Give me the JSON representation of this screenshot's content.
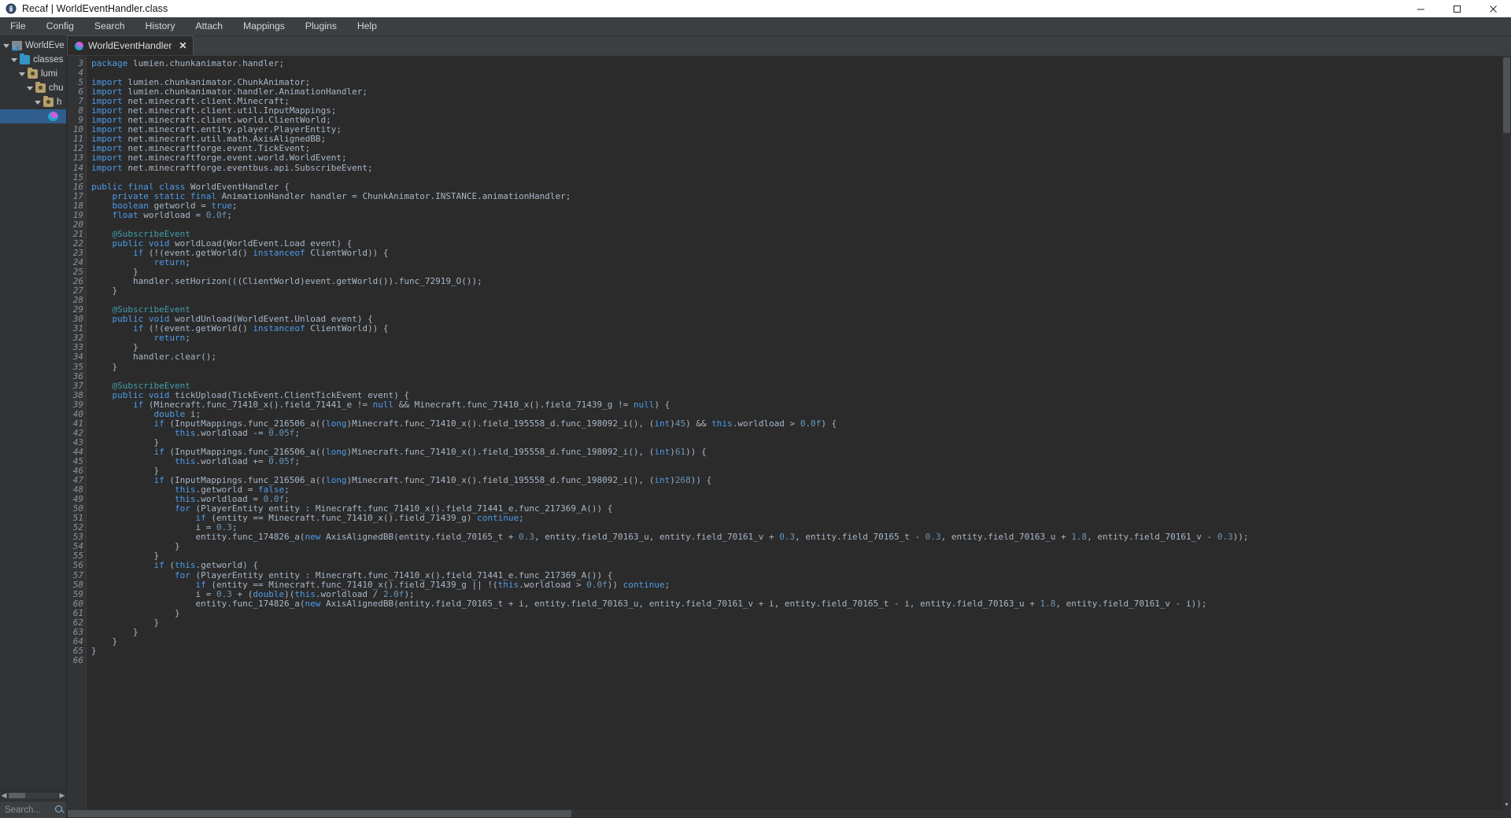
{
  "window": {
    "title": "Recaf | WorldEventHandler.class",
    "icon": "recaf-app-icon",
    "controls": {
      "minimize": "—",
      "maximize": "❐",
      "close": "✕"
    }
  },
  "menubar": {
    "items": [
      {
        "label": "File",
        "name": "menu-file"
      },
      {
        "label": "Config",
        "name": "menu-config"
      },
      {
        "label": "Search",
        "name": "menu-search"
      },
      {
        "label": "History",
        "name": "menu-history"
      },
      {
        "label": "Attach",
        "name": "menu-attach"
      },
      {
        "label": "Mappings",
        "name": "menu-mappings"
      },
      {
        "label": "Plugins",
        "name": "menu-plugins"
      },
      {
        "label": "Help",
        "name": "menu-help"
      }
    ]
  },
  "sidebar": {
    "tree": [
      {
        "label": "WorldEve",
        "icon": "jar-icon",
        "depth": 0,
        "expanded": true,
        "selected": false
      },
      {
        "label": "classes",
        "icon": "folder-blue-icon",
        "depth": 1,
        "expanded": true,
        "selected": false
      },
      {
        "label": "lumi",
        "icon": "folder-package-icon",
        "depth": 2,
        "expanded": true,
        "selected": false
      },
      {
        "label": "chu",
        "icon": "folder-package-icon",
        "depth": 3,
        "expanded": true,
        "selected": false
      },
      {
        "label": "h",
        "icon": "folder-package-icon",
        "depth": 4,
        "expanded": true,
        "selected": false
      },
      {
        "label": "",
        "icon": "class-icon",
        "depth": 5,
        "expanded": false,
        "selected": true
      }
    ],
    "search": {
      "placeholder": "Search...",
      "value": "",
      "icon": "search-icon"
    },
    "scroll": {
      "left_icon": "chevron-left-icon",
      "right_icon": "chevron-right-icon"
    }
  },
  "editor": {
    "tabs": [
      {
        "label": "WorldEventHandler",
        "icon": "class-icon",
        "close": "✕",
        "active": true
      }
    ],
    "first_line_number": 3,
    "line_numbers": [
      3,
      4,
      5,
      6,
      7,
      8,
      9,
      10,
      11,
      12,
      13,
      14,
      15,
      16,
      17,
      18,
      19,
      20,
      21,
      22,
      23,
      24,
      25,
      26,
      27,
      28,
      29,
      30,
      31,
      32,
      33,
      34,
      35,
      36,
      37,
      38,
      39,
      40,
      41,
      42,
      43,
      44,
      45,
      46,
      47,
      48,
      49,
      50,
      51,
      52,
      53,
      54,
      55,
      56,
      57,
      58,
      59,
      60,
      61,
      62,
      63,
      64,
      65,
      66
    ],
    "code_lines": [
      "package lumien.chunkanimator.handler;",
      "",
      "import lumien.chunkanimator.ChunkAnimator;",
      "import lumien.chunkanimator.handler.AnimationHandler;",
      "import net.minecraft.client.Minecraft;",
      "import net.minecraft.client.util.InputMappings;",
      "import net.minecraft.client.world.ClientWorld;",
      "import net.minecraft.entity.player.PlayerEntity;",
      "import net.minecraft.util.math.AxisAlignedBB;",
      "import net.minecraftforge.event.TickEvent;",
      "import net.minecraftforge.event.world.WorldEvent;",
      "import net.minecraftforge.eventbus.api.SubscribeEvent;",
      "",
      "public final class WorldEventHandler {",
      "    private static final AnimationHandler handler = ChunkAnimator.INSTANCE.animationHandler;",
      "    boolean getworld = true;",
      "    float worldload = 0.0f;",
      "",
      "    @SubscribeEvent",
      "    public void worldLoad(WorldEvent.Load event) {",
      "        if (!(event.getWorld() instanceof ClientWorld)) {",
      "            return;",
      "        }",
      "        handler.setHorizon(((ClientWorld)event.getWorld()).func_72919_O());",
      "    }",
      "",
      "    @SubscribeEvent",
      "    public void worldUnload(WorldEvent.Unload event) {",
      "        if (!(event.getWorld() instanceof ClientWorld)) {",
      "            return;",
      "        }",
      "        handler.clear();",
      "    }",
      "",
      "    @SubscribeEvent",
      "    public void tickUpload(TickEvent.ClientTickEvent event) {",
      "        if (Minecraft.func_71410_x().field_71441_e != null && Minecraft.func_71410_x().field_71439_g != null) {",
      "            double i;",
      "            if (InputMappings.func_216506_a((long)Minecraft.func_71410_x().field_195558_d.func_198092_i(), (int)45) && this.worldload > 0.0f) {",
      "                this.worldload -= 0.05f;",
      "            }",
      "            if (InputMappings.func_216506_a((long)Minecraft.func_71410_x().field_195558_d.func_198092_i(), (int)61)) {",
      "                this.worldload += 0.05f;",
      "            }",
      "            if (InputMappings.func_216506_a((long)Minecraft.func_71410_x().field_195558_d.func_198092_i(), (int)268)) {",
      "                this.getworld = false;",
      "                this.worldload = 0.0f;",
      "                for (PlayerEntity entity : Minecraft.func_71410_x().field_71441_e.func_217369_A()) {",
      "                    if (entity == Minecraft.func_71410_x().field_71439_g) continue;",
      "                    i = 0.3;",
      "                    entity.func_174826_a(new AxisAlignedBB(entity.field_70165_t + 0.3, entity.field_70163_u, entity.field_70161_v + 0.3, entity.field_70165_t - 0.3, entity.field_70163_u + 1.8, entity.field_70161_v - 0.3));",
      "                }",
      "            }",
      "            if (this.getworld) {",
      "                for (PlayerEntity entity : Minecraft.func_71410_x().field_71441_e.func_217369_A()) {",
      "                    if (entity == Minecraft.func_71410_x().field_71439_g || !(this.worldload > 0.0f)) continue;",
      "                    i = 0.3 + (double)(this.worldload / 2.0f);",
      "                    entity.func_174826_a(new AxisAlignedBB(entity.field_70165_t + i, entity.field_70163_u, entity.field_70161_v + i, entity.field_70165_t - i, entity.field_70163_u + 1.8, entity.field_70161_v - i));",
      "                }",
      "            }",
      "        }",
      "    }",
      "}",
      ""
    ]
  },
  "colors": {
    "bg_editor": "#2b2b2b",
    "bg_panel": "#313335",
    "bg_menu": "#3c3f41",
    "text": "#a9b7c6",
    "keyword_orange": "#cc7832",
    "keyword_blue": "#4d9bea",
    "number": "#6897bb",
    "annotation": "#3f9dad",
    "selection": "#2f5d8c"
  }
}
